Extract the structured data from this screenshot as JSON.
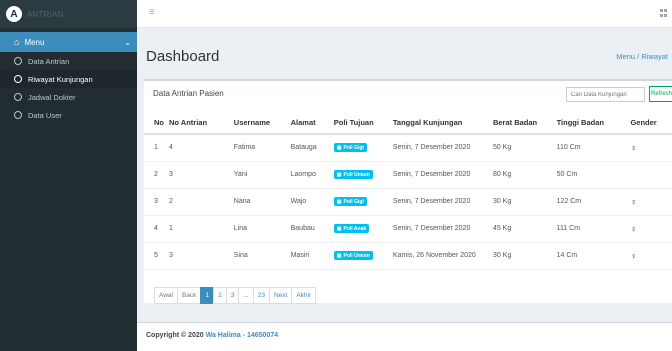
{
  "brand": {
    "logo_letter": "A",
    "name": "ANTRIAN"
  },
  "sidebar": {
    "menu_label": "Menu",
    "items": [
      {
        "label": "Data Antrian",
        "active": false
      },
      {
        "label": "Riwayat Kunjungan",
        "active": true
      },
      {
        "label": "Jadwal Dokter",
        "active": false
      },
      {
        "label": "Data User",
        "active": false
      }
    ]
  },
  "page": {
    "title": "Dashboard",
    "breadcrumb_home": "Menu",
    "breadcrumb_current": "Riwayat"
  },
  "box": {
    "title": "Data Antrian Pasien",
    "search_placeholder": "Cari Data Kunjungan",
    "refresh_label": "Refresh"
  },
  "table": {
    "headers": [
      "No",
      "No Antrian",
      "Username",
      "Alamat",
      "Poli Tujuan",
      "Tanggal Kunjungan",
      "Berat Badan",
      "Tinggi Badan",
      "Gender"
    ],
    "rows": [
      {
        "no": "1",
        "antrian": "4",
        "username": "Fatima",
        "alamat": "Batauga",
        "poli": "Poli Gigi",
        "poli_color": "#00c0ef",
        "tanggal": "Senin, 7 Desember 2020",
        "berat": "50 Kg",
        "tinggi": "110 Cm",
        "gender_icon": "female-icon"
      },
      {
        "no": "2",
        "antrian": "3",
        "username": "Yani",
        "alamat": "Laompo",
        "poli": "Poli Umum",
        "poli_color": "#00c0ef",
        "tanggal": "Senin, 7 Desember 2020",
        "berat": "80 Kg",
        "tinggi": "50 Cm",
        "gender_icon": ""
      },
      {
        "no": "3",
        "antrian": "2",
        "username": "Nana",
        "alamat": "Wajo",
        "poli": "Poli Gigi",
        "poli_color": "#00c0ef",
        "tanggal": "Senin, 7 Desember 2020",
        "berat": "30 Kg",
        "tinggi": "122 Cm",
        "gender_icon": "female-icon"
      },
      {
        "no": "4",
        "antrian": "1",
        "username": "Lina",
        "alamat": "Baubau",
        "poli": "Poli Anak",
        "poli_color": "#00c0ef",
        "tanggal": "Senin, 7 Desember 2020",
        "berat": "45 Kg",
        "tinggi": "111 Cm",
        "gender_icon": "female-icon"
      },
      {
        "no": "5",
        "antrian": "3",
        "username": "Sina",
        "alamat": "Masiri",
        "poli": "Poli Umum",
        "poli_color": "#00c0ef",
        "tanggal": "Kamis, 26 November 2020",
        "berat": "30 Kg",
        "tinggi": "14 Cm",
        "gender_icon": "female-icon"
      }
    ]
  },
  "pagination": {
    "first": "Awal",
    "back": "Back",
    "pages": [
      "1",
      "2",
      "3",
      "...",
      "23"
    ],
    "current": "1",
    "next": "Next",
    "last": "Akhir"
  },
  "footer": {
    "prefix": "Copyright © 2020",
    "highlight": "Wa Halima - 14650074"
  },
  "colors": {
    "accent": "#3c8dbc",
    "sidebar": "#222d32",
    "success": "#00a65a"
  }
}
